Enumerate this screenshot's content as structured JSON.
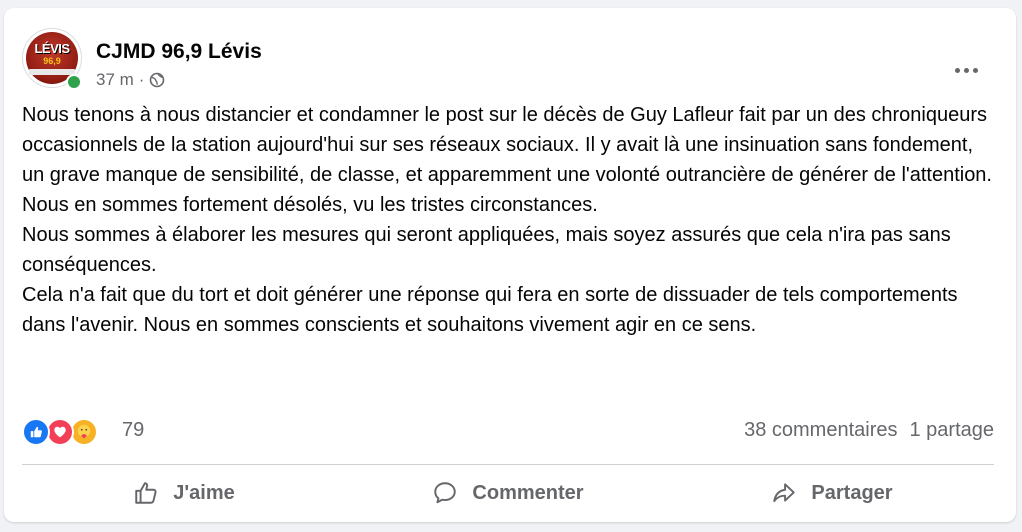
{
  "post": {
    "page_name": "CJMD 96,9 Lévis",
    "time": "37 m",
    "separator": "·",
    "privacy_icon": "globe-icon",
    "avatar": {
      "logo_text": "LÉVIS",
      "logo_sub": "96,9"
    },
    "paragraphs": [
      "Nous tenons à nous distancier et condamner le post sur le décès de Guy Lafleur fait par un des chroniqueurs occasionnels de la station aujourd'hui sur ses réseaux sociaux. Il y avait là une insinuation sans fondement, un grave manque de sensibilité, de classe, et apparemment une volonté outrancière de générer de l'attention.",
      "Nous en sommes fortement désolés, vu les tristes circonstances.",
      "Nous sommes à élaborer les mesures qui seront appliquées, mais soyez assurés que cela n'ira pas sans conséquences.",
      "Cela n'a fait que du tort et doit générer une réponse qui fera en sorte de dissuader de tels comportements dans l'avenir. Nous en sommes conscients et souhaitons vivement agir en ce sens."
    ]
  },
  "reactions": {
    "types": [
      "like",
      "love",
      "care"
    ],
    "count": "79",
    "comments": "38 commentaires",
    "shares": "1 partage"
  },
  "actions": {
    "like_label": "J'aime",
    "comment_label": "Commenter",
    "share_label": "Partager"
  },
  "colors": {
    "like": "#1877f2",
    "love": "#f33e58",
    "care": "#f7b125",
    "online": "#31a24c",
    "secondary_text": "#65676b"
  }
}
